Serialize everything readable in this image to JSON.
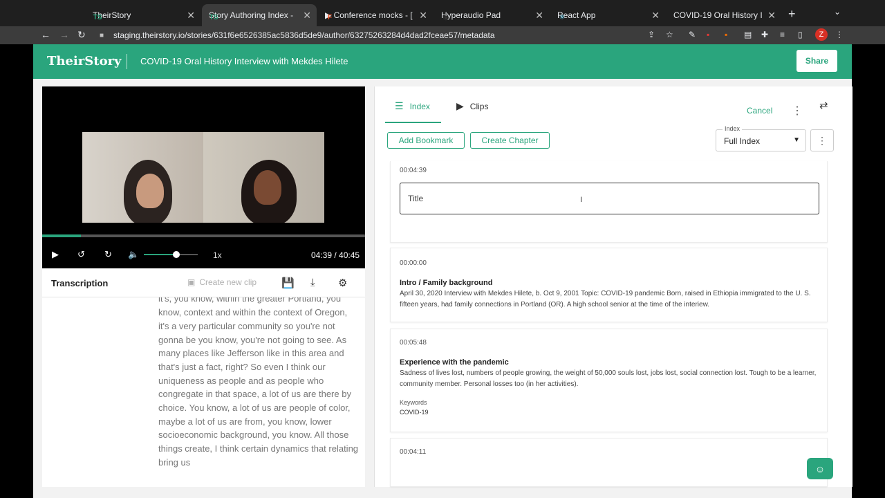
{
  "browser": {
    "tabs": [
      {
        "label": "TheirStory",
        "icon": "TS"
      },
      {
        "label": "Story Authoring Index - ",
        "icon": "TS"
      },
      {
        "label": "▶ Conference mocks - [",
        "icon": "F"
      },
      {
        "label": "Hyperaudio Pad",
        "icon": "◉"
      },
      {
        "label": "React App",
        "icon": "⚛"
      },
      {
        "label": "COVID-19 Oral History I",
        "icon": "○"
      }
    ],
    "url": "staging.theirstory.io/stories/631f6e6526385ac5836d5de9/author/63275263284d4dad2fceae57/metadata",
    "profile_initial": "Z"
  },
  "header": {
    "logo": "TheirStory",
    "title": "COVID-19 Oral History Interview with Mekdes Hilete",
    "share_label": "Share"
  },
  "player": {
    "time": "04:39 / 40:45",
    "rate": "1x",
    "progress_fraction": 0.12,
    "volume_fraction": 0.6
  },
  "transcription": {
    "title": "Transcription",
    "create_clip": "Create new clip",
    "text": "color that Jefferson is a pretty like it's it's a very particular type of community that you're not and it's, you know, within the greater Portland, you know, context and within the context of Oregon, it's a very particular community so you're not gonna be you know, you're not going to see. As many places like Jefferson like in this area and that's just a fact, right? So even I think our uniqueness as people and as people who congregate in that space, a lot of us are there by choice. You know, a lot of us are people of color, maybe a lot of us are from, you know, lower socioeconomic background, you know. All those things create, I think certain dynamics that relating bring us"
  },
  "index_panel": {
    "tabs": [
      {
        "label": "Index"
      },
      {
        "label": "Clips"
      }
    ],
    "cancel": "Cancel",
    "add_bookmark": "Add Bookmark",
    "create_chapter": "Create Chapter",
    "select_label": "Index",
    "select_value": "Full Index",
    "editing": {
      "timestamp": "00:04:39",
      "title_placeholder": "Title"
    },
    "chapters": [
      {
        "timestamp": "00:00:00",
        "title": "Intro / Family background",
        "description": "April 30, 2020 Interview with Mekdes Hilete, b. Oct 9, 2001 Topic: COVID-19 pandemic Born, raised in Ethiopia immigrated to the U. S. fifteen years, had family connections in Portland (OR). A high school senior at the time of the interiew."
      },
      {
        "timestamp": "00:05:48",
        "title": "Experience with the pandemic",
        "description": "Sadness of lives lost, numbers of people growing, the weight of 50,000 souls lost, jobs lost, social connection lost. Tough to be a learner, community member. Personal losses too (in her activities).",
        "keywords_label": "Keywords",
        "keywords": "COVID-19"
      },
      {
        "timestamp": "00:04:11"
      }
    ]
  },
  "colors": {
    "brand": "#2aa57d"
  }
}
